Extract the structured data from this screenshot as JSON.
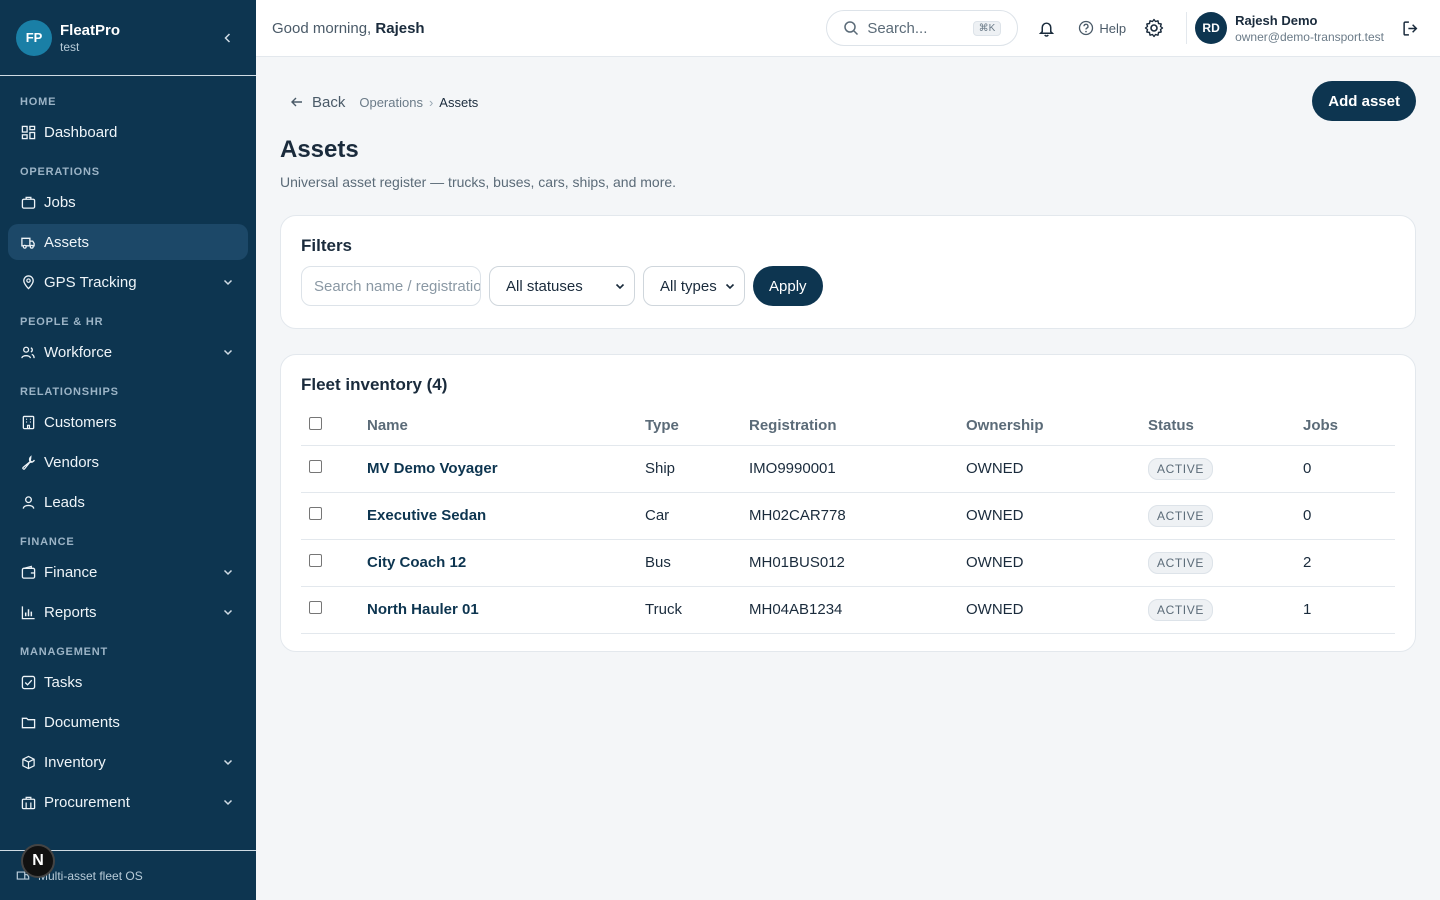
{
  "brand": {
    "initials": "FP",
    "name": "FleatPro",
    "sub": "test"
  },
  "nav": {
    "home_label": "HOME",
    "dashboard": "Dashboard",
    "operations_label": "OPERATIONS",
    "jobs": "Jobs",
    "assets": "Assets",
    "gps": "GPS Tracking",
    "people_label": "PEOPLE & HR",
    "workforce": "Workforce",
    "relationships_label": "RELATIONSHIPS",
    "customers": "Customers",
    "vendors": "Vendors",
    "leads": "Leads",
    "finance_label": "FINANCE",
    "finance": "Finance",
    "reports": "Reports",
    "management_label": "MANAGEMENT",
    "tasks": "Tasks",
    "documents": "Documents",
    "inventory": "Inventory",
    "procurement": "Procurement"
  },
  "footer": {
    "text": "Multi-asset fleet OS",
    "badge": "N"
  },
  "topbar": {
    "greeting": "Good morning,",
    "greeting_name": "Rajesh",
    "search_placeholder": "Search...",
    "search_kbd": "⌘K",
    "help": "Help",
    "user_initials": "RD",
    "user_name": "Rajesh Demo",
    "user_email": "owner@demo-transport.test"
  },
  "breadcrumb": {
    "back": "Back",
    "parent": "Operations",
    "current": "Assets"
  },
  "page": {
    "title": "Assets",
    "subtitle": "Universal asset register — trucks, buses, cars, ships, and more.",
    "add_button": "Add asset"
  },
  "filters": {
    "title": "Filters",
    "search_placeholder": "Search name / registration",
    "status_value": "All statuses",
    "type_value": "All types",
    "apply": "Apply"
  },
  "inventory": {
    "title": "Fleet inventory (4)",
    "columns": [
      "Name",
      "Type",
      "Registration",
      "Ownership",
      "Status",
      "Jobs"
    ],
    "rows": [
      {
        "name": "MV Demo Voyager",
        "type": "Ship",
        "registration": "IMO9990001",
        "ownership": "OWNED",
        "status": "ACTIVE",
        "jobs": "0"
      },
      {
        "name": "Executive Sedan",
        "type": "Car",
        "registration": "MH02CAR778",
        "ownership": "OWNED",
        "status": "ACTIVE",
        "jobs": "0"
      },
      {
        "name": "City Coach 12",
        "type": "Bus",
        "registration": "MH01BUS012",
        "ownership": "OWNED",
        "status": "ACTIVE",
        "jobs": "2"
      },
      {
        "name": "North Hauler 01",
        "type": "Truck",
        "registration": "MH04AB1234",
        "ownership": "OWNED",
        "status": "ACTIVE",
        "jobs": "1"
      }
    ]
  },
  "colors": {
    "sidebar": "#0d3550",
    "accent": "#1a7fa6"
  }
}
